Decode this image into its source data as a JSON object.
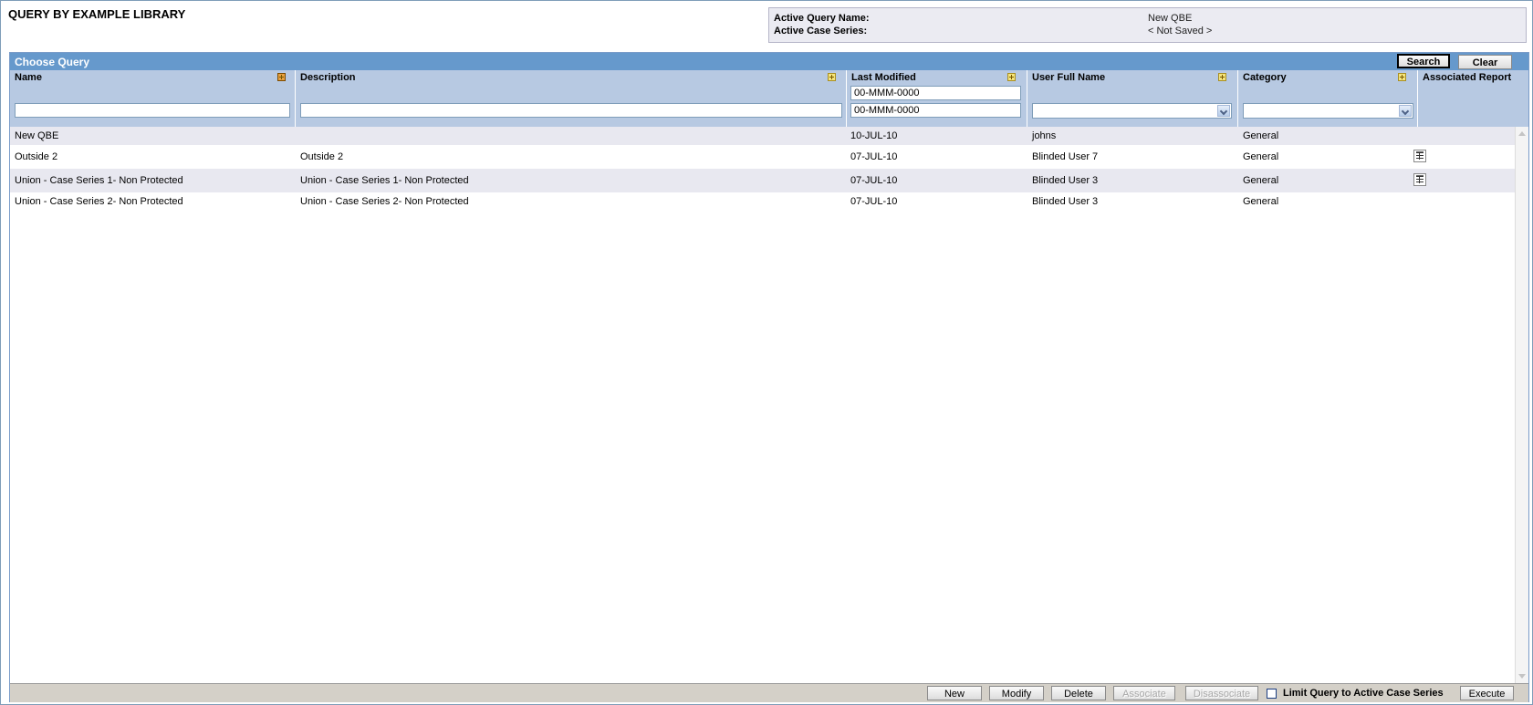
{
  "page": {
    "title": "QUERY BY EXAMPLE LIBRARY"
  },
  "active": {
    "query_name_label": "Active Query Name:",
    "query_name_value": "New QBE",
    "case_series_label": "Active Case Series:",
    "case_series_value": "< Not Saved >"
  },
  "panel": {
    "title": "Choose Query",
    "search_label": "Search",
    "clear_label": "Clear"
  },
  "columns": {
    "name": "Name",
    "description": "Description",
    "last_modified": "Last Modified",
    "user_full_name": "User Full Name",
    "category": "Category",
    "associated_report": "Associated Report"
  },
  "filters": {
    "name_value": "",
    "description_value": "",
    "date_from": "00-MMM-0000",
    "date_to": "00-MMM-0000",
    "user_value": "",
    "category_value": ""
  },
  "rows": [
    {
      "name": "New QBE",
      "description": "",
      "last_modified": "10-JUL-10",
      "user": "johns",
      "category": "General",
      "report": false
    },
    {
      "name": "Outside 2",
      "description": "Outside 2",
      "last_modified": "07-JUL-10",
      "user": "Blinded User 7",
      "category": "General",
      "report": true
    },
    {
      "name": "Union - Case Series 1- Non Protected",
      "description": "Union - Case Series 1- Non Protected",
      "last_modified": "07-JUL-10",
      "user": "Blinded User 3",
      "category": "General",
      "report": true
    },
    {
      "name": "Union - Case Series 2- Non Protected",
      "description": "Union - Case Series 2- Non Protected",
      "last_modified": "07-JUL-10",
      "user": "Blinded User 3",
      "category": "General",
      "report": false
    }
  ],
  "footer": {
    "new_label": "New",
    "modify_label": "Modify",
    "delete_label": "Delete",
    "associate_label": "Associate",
    "disassociate_label": "Disassociate",
    "limit_label": "Limit Query to Active Case Series",
    "limit_checked": false,
    "execute_label": "Execute"
  },
  "icons": {
    "sort": "sort-plus-icon",
    "report": "report-icon",
    "dropdown": "chevron-down-icon"
  },
  "colors": {
    "panel_header": "#6699cc",
    "grid_header": "#b7c9e2",
    "alt_row": "#e8e8f0",
    "footer": "#d4d0c8"
  }
}
